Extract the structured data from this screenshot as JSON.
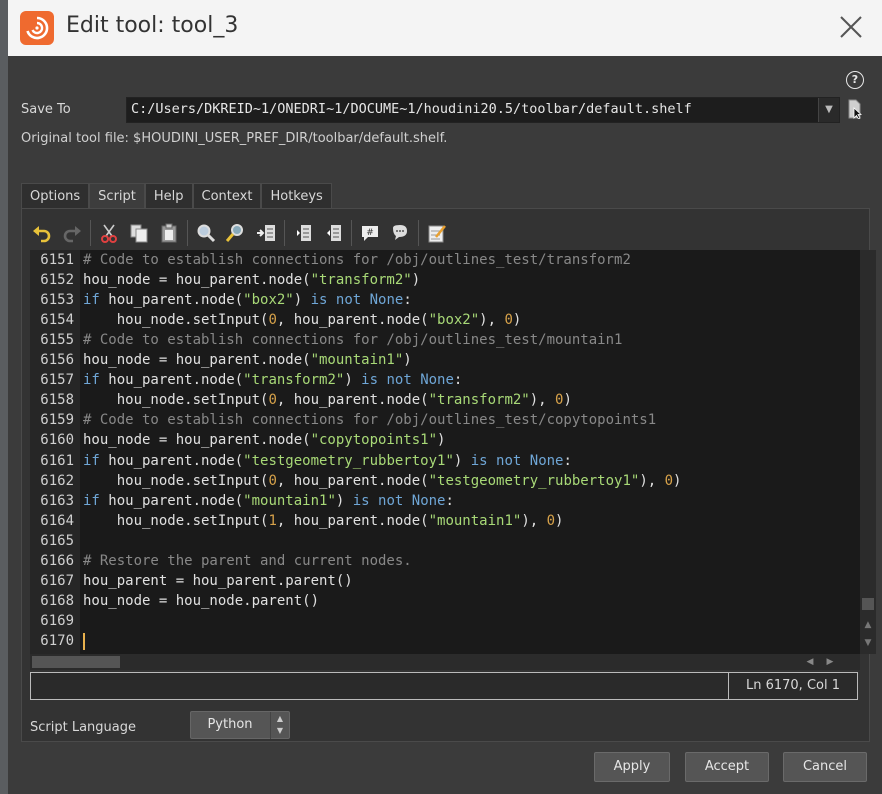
{
  "window": {
    "title": "Edit tool: tool_3"
  },
  "save_to": {
    "label": "Save To",
    "value": "C:/Users/DKREID~1/ONEDRI~1/DOCUME~1/houdini20.5/toolbar/default.shelf"
  },
  "original_tool_file": "Original tool file: $HOUDINI_USER_PREF_DIR/toolbar/default.shelf.",
  "tabs": [
    "Options",
    "Script",
    "Help",
    "Context",
    "Hotkeys"
  ],
  "active_tab": "Script",
  "toolbar_icons": [
    "undo-icon",
    "redo-icon",
    "cut-icon",
    "copy-icon",
    "paste-icon",
    "find-icon",
    "find-replace-icon",
    "goto-line-icon",
    "indent-icon",
    "unindent-icon",
    "comment-icon",
    "uncomment-icon",
    "edit-external-icon"
  ],
  "code": {
    "line_numbers": [
      "6151",
      "6152",
      "6153",
      "6154",
      "6155",
      "6156",
      "6157",
      "6158",
      "6159",
      "6160",
      "6161",
      "6162",
      "6163",
      "6164",
      "6165",
      "6166",
      "6167",
      "6168",
      "6169",
      "6170"
    ],
    "lines": [
      "# Code to establish connections for /obj/outlines_test/transform2",
      "hou_node = hou_parent.node(\"transform2\")",
      "if hou_parent.node(\"box2\") is not None:",
      "    hou_node.setInput(0, hou_parent.node(\"box2\"), 0)",
      "# Code to establish connections for /obj/outlines_test/mountain1",
      "hou_node = hou_parent.node(\"mountain1\")",
      "if hou_parent.node(\"transform2\") is not None:",
      "    hou_node.setInput(0, hou_parent.node(\"transform2\"), 0)",
      "# Code to establish connections for /obj/outlines_test/copytopoints1",
      "hou_node = hou_parent.node(\"copytopoints1\")",
      "if hou_parent.node(\"testgeometry_rubbertoy1\") is not None:",
      "    hou_node.setInput(0, hou_parent.node(\"testgeometry_rubbertoy1\"), 0)",
      "if hou_parent.node(\"mountain1\") is not None:",
      "    hou_node.setInput(1, hou_parent.node(\"mountain1\"), 0)",
      "",
      "# Restore the parent and current nodes.",
      "hou_parent = hou_parent.parent()",
      "hou_node = hou_node.parent()",
      "",
      ""
    ]
  },
  "status": {
    "cursor_position": "Ln 6170, Col 1"
  },
  "script_language": {
    "label": "Script Language",
    "value": "Python"
  },
  "buttons": {
    "apply": "Apply",
    "accept": "Accept",
    "cancel": "Cancel"
  },
  "colors": {
    "accent": "#ef6a2f",
    "keyword": "#6fa6d6",
    "string": "#a8d977",
    "number": "#d7a24a",
    "comment": "#888888"
  }
}
